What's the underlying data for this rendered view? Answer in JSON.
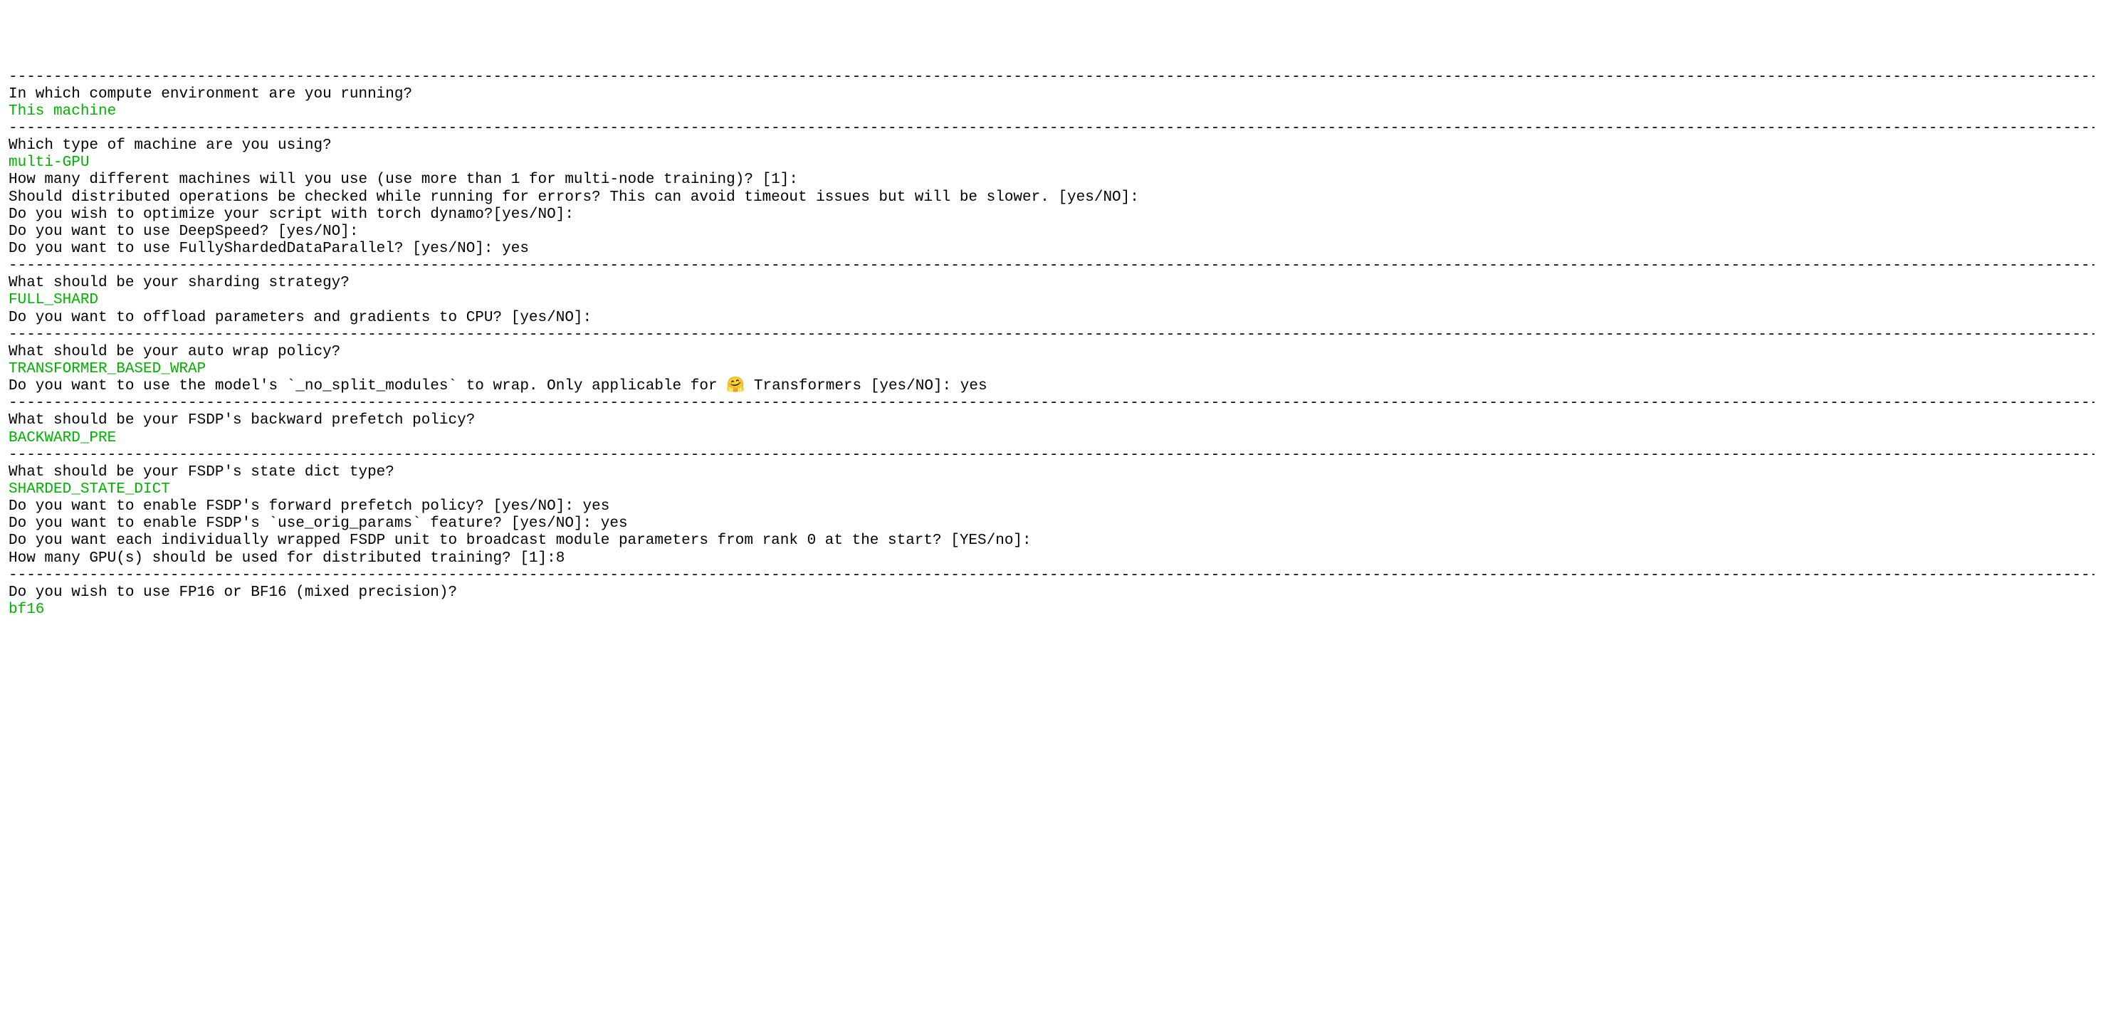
{
  "dash": "----------------------------------------------------------------------------------------------------------------------------------------------------------------------------------------------------------------------------------------------------------------------------------------------------------",
  "sections": [
    {
      "type": "dash"
    },
    {
      "type": "prompt",
      "text": "In which compute environment are you running?"
    },
    {
      "type": "answer",
      "text": "This machine"
    },
    {
      "type": "dash"
    },
    {
      "type": "prompt",
      "text": "Which type of machine are you using?"
    },
    {
      "type": "answer",
      "text": "multi-GPU"
    },
    {
      "type": "prompt",
      "text": "How many different machines will you use (use more than 1 for multi-node training)? [1]:"
    },
    {
      "type": "prompt",
      "text": "Should distributed operations be checked while running for errors? This can avoid timeout issues but will be slower. [yes/NO]:"
    },
    {
      "type": "prompt",
      "text": "Do you wish to optimize your script with torch dynamo?[yes/NO]:"
    },
    {
      "type": "prompt",
      "text": "Do you want to use DeepSpeed? [yes/NO]:"
    },
    {
      "type": "prompt",
      "text": "Do you want to use FullyShardedDataParallel? [yes/NO]: yes"
    },
    {
      "type": "dash"
    },
    {
      "type": "prompt",
      "text": "What should be your sharding strategy?"
    },
    {
      "type": "answer",
      "text": "FULL_SHARD"
    },
    {
      "type": "prompt",
      "text": "Do you want to offload parameters and gradients to CPU? [yes/NO]:"
    },
    {
      "type": "dash"
    },
    {
      "type": "prompt",
      "text": "What should be your auto wrap policy?"
    },
    {
      "type": "answer",
      "text": "TRANSFORMER_BASED_WRAP"
    },
    {
      "type": "prompt",
      "text": "Do you want to use the model's `_no_split_modules` to wrap. Only applicable for 🤗 Transformers [yes/NO]: yes"
    },
    {
      "type": "dash"
    },
    {
      "type": "prompt",
      "text": "What should be your FSDP's backward prefetch policy?"
    },
    {
      "type": "answer",
      "text": "BACKWARD_PRE"
    },
    {
      "type": "dash"
    },
    {
      "type": "prompt",
      "text": "What should be your FSDP's state dict type?"
    },
    {
      "type": "answer",
      "text": "SHARDED_STATE_DICT"
    },
    {
      "type": "prompt",
      "text": "Do you want to enable FSDP's forward prefetch policy? [yes/NO]: yes"
    },
    {
      "type": "prompt",
      "text": "Do you want to enable FSDP's `use_orig_params` feature? [yes/NO]: yes"
    },
    {
      "type": "prompt",
      "text": "Do you want each individually wrapped FSDP unit to broadcast module parameters from rank 0 at the start? [YES/no]:"
    },
    {
      "type": "prompt",
      "text": "How many GPU(s) should be used for distributed training? [1]:8"
    },
    {
      "type": "dash"
    },
    {
      "type": "prompt",
      "text": "Do you wish to use FP16 or BF16 (mixed precision)?"
    },
    {
      "type": "answer",
      "text": "bf16"
    }
  ]
}
